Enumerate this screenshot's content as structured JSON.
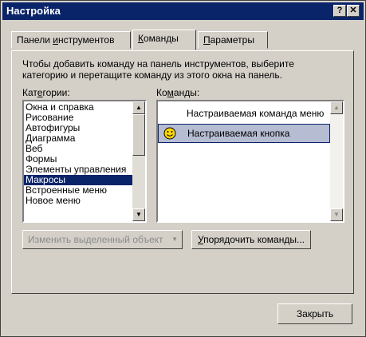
{
  "window": {
    "title": "Настройка",
    "help_label": "?",
    "close_label": "✕"
  },
  "tabs": [
    {
      "pre": "Панели ",
      "acc": "и",
      "post": "нструментов"
    },
    {
      "pre": "",
      "acc": "К",
      "post": "оманды"
    },
    {
      "pre": "",
      "acc": "П",
      "post": "араметры"
    }
  ],
  "description": "Чтобы добавить команду на панель инструментов, выберите категорию и перетащите команду из этого окна на панель.",
  "categories_label": {
    "pre": "Кат",
    "acc": "е",
    "post": "гории:"
  },
  "commands_label": {
    "pre": "Ко",
    "acc": "м",
    "post": "анды:"
  },
  "categories": [
    "Окна и справка",
    "Рисование",
    "Автофигуры",
    "Диаграмма",
    "Веб",
    "Формы",
    "Элементы управления",
    "Макросы",
    "Встроенные меню",
    "Новое меню"
  ],
  "selected_category": "Макросы",
  "commands": [
    {
      "label": "Настраиваемая команда меню",
      "icon": "none"
    },
    {
      "label": "Настраиваемая кнопка",
      "icon": "smiley-icon"
    }
  ],
  "buttons": {
    "modify_selection": "Изменить выделенный объект",
    "modify_arrow": "▼",
    "rearrange": {
      "pre": "",
      "acc": "У",
      "post": "порядочить команды..."
    },
    "close": "Закрыть"
  },
  "scroll_arrows": {
    "up": "▲",
    "down": "▼"
  },
  "colors": {
    "titlebar": "#0a246a",
    "selection": "#0a246a",
    "command_highlight": "#b6bdd2",
    "face": "#d4d0c8"
  }
}
